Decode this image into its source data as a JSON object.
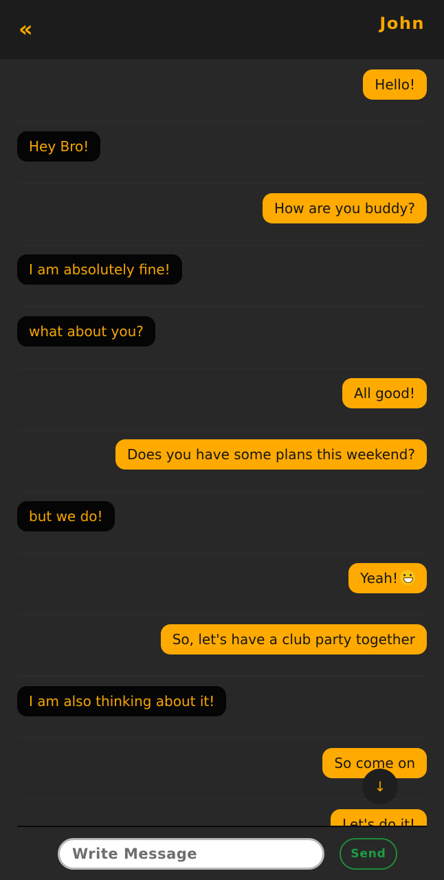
{
  "header": {
    "back_icon": "«",
    "contact_name": "John"
  },
  "messages": [
    {
      "text": "Hello!",
      "sender": "me"
    },
    {
      "text": "Hey Bro!",
      "sender": "them"
    },
    {
      "text": "How are you buddy?",
      "sender": "me"
    },
    {
      "text": "I am absolutely fine!",
      "sender": "them"
    },
    {
      "text": "what about you?",
      "sender": "them"
    },
    {
      "text": "All good!",
      "sender": "me"
    },
    {
      "text": "Does you have some plans this weekend?",
      "sender": "me"
    },
    {
      "text": "but we do!",
      "sender": "them"
    },
    {
      "text": "Yeah!",
      "sender": "me",
      "emoji": "grinning-face-icon"
    },
    {
      "text": "So, let's have a club party together",
      "sender": "me"
    },
    {
      "text": "I am also thinking about it!",
      "sender": "them"
    },
    {
      "text": "So come on",
      "sender": "me"
    },
    {
      "text": "Let's do it!",
      "sender": "me"
    }
  ],
  "scroll_down": {
    "icon": "↓"
  },
  "composer": {
    "placeholder": "Write Message",
    "send_label": "Send"
  },
  "colors": {
    "accent": "#ffaa00",
    "background": "#282828",
    "header": "#1c1c1c",
    "received_bubble": "#050505",
    "send_button": "#1f9d42"
  }
}
